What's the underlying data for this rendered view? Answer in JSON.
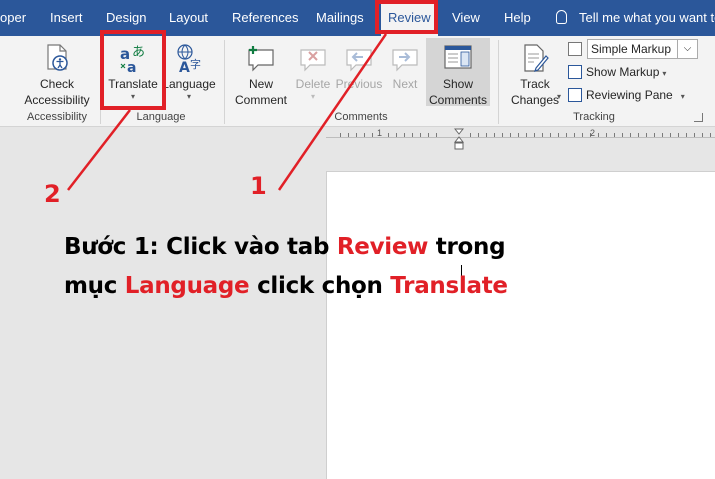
{
  "tabs": [
    "oper",
    "Insert",
    "Design",
    "Layout",
    "References",
    "Mailings",
    "Review",
    "View",
    "Help"
  ],
  "tell_me": "Tell me what you want to",
  "ribbon": {
    "accessibility": {
      "check_line1": "Check",
      "check_line2": "Accessibility",
      "group": "Accessibility"
    },
    "language": {
      "translate": "Translate",
      "language": "Language",
      "group": "Language"
    },
    "comments": {
      "new_line1": "New",
      "new_line2": "Comment",
      "delete": "Delete",
      "previous": "Previous",
      "next": "Next",
      "show_line1": "Show",
      "show_line2": "Comments",
      "group": "Comments"
    },
    "tracking": {
      "track_line1": "Track",
      "track_line2": "Changes",
      "markup_select": "Simple Markup",
      "show_markup": "Show Markup",
      "reviewing_pane": "Reviewing Pane",
      "group": "Tracking"
    }
  },
  "ruler": {
    "numbers": [
      "1",
      "2"
    ]
  },
  "callouts": {
    "one": "1",
    "two": "2"
  },
  "instruction": {
    "line1_a": "Bước 1: Click vào tab ",
    "line1_b": "Review",
    "line1_c": " trong",
    "line2_a": "mục ",
    "line2_b": "Language",
    "line2_c": " click chọn ",
    "line2_d": "Translate"
  },
  "colors": {
    "accent": "#2b579a",
    "annotation": "#e12027"
  }
}
